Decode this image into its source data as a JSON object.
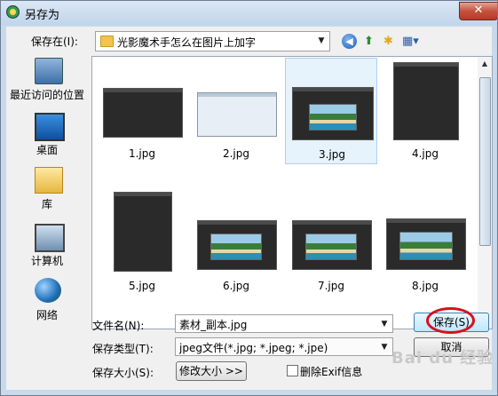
{
  "window": {
    "title": "另存为",
    "close_glyph": "✕"
  },
  "toolbar": {
    "save_in_label": "保存在(I):",
    "current_folder": "光影魔术手怎么在图片上加字",
    "views_glyph": "▦▾"
  },
  "places": [
    {
      "label": "最近访问的位置",
      "icon": "recent-places-icon"
    },
    {
      "label": "桌面",
      "icon": "desktop-icon"
    },
    {
      "label": "库",
      "icon": "library-icon"
    },
    {
      "label": "计算机",
      "icon": "computer-icon"
    },
    {
      "label": "网络",
      "icon": "network-icon"
    }
  ],
  "files": [
    {
      "name": "1.jpg",
      "kind": "dark-ui"
    },
    {
      "name": "2.jpg",
      "kind": "window"
    },
    {
      "name": "3.jpg",
      "kind": "scene",
      "selected": true
    },
    {
      "name": "4.jpg",
      "kind": "dark-panel"
    },
    {
      "name": "5.jpg",
      "kind": "dark-panel"
    },
    {
      "name": "6.jpg",
      "kind": "scene-ui"
    },
    {
      "name": "7.jpg",
      "kind": "scene-ui"
    },
    {
      "name": "8.jpg",
      "kind": "scene-ui"
    }
  ],
  "form": {
    "filename_label": "文件名(N):",
    "filename_value": "素材_副本.jpg",
    "filetype_label": "保存类型(T):",
    "filetype_value": "jpeg文件(*.jpg; *.jpeg; *.jpe)",
    "size_label": "保存大小(S):",
    "resize_button": "修改大小 >>",
    "delete_exif_label": "删除Exif信息",
    "delete_exif_checked": false,
    "save_button": "保存(S)",
    "cancel_button": "取消"
  },
  "watermark": "Bai du 经验",
  "colors": {
    "highlight_circle": "#d8101a",
    "selection": "#e6f2fc"
  }
}
